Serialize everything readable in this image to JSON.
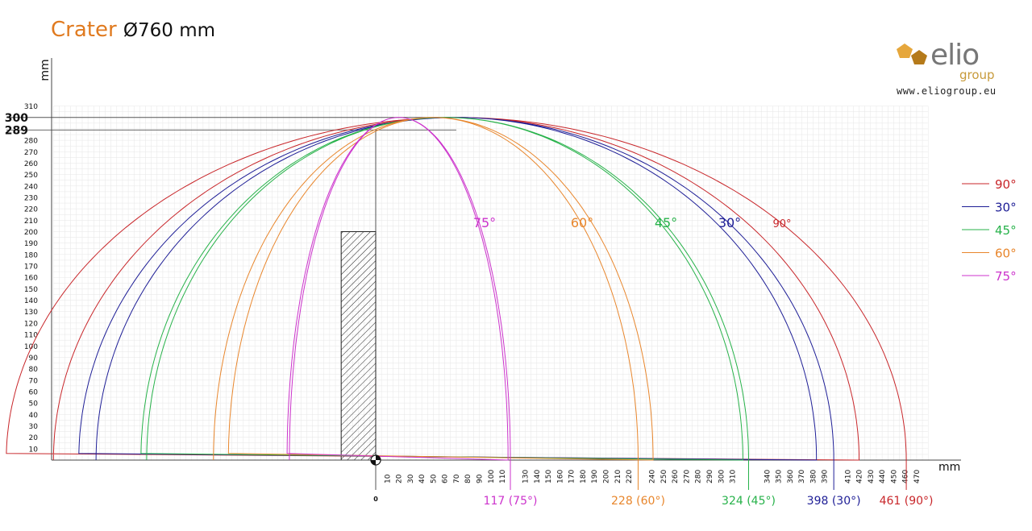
{
  "title": {
    "name": "Crater",
    "size": "Ø760 mm",
    "name_color": "#E07A1F"
  },
  "logo": {
    "brand": "elio",
    "sub": "group",
    "url": "www.eliogroup.eu",
    "mark": "pentagon-icon",
    "mark_colors": [
      "#E6A73C",
      "#B57A1A"
    ]
  },
  "chart_data": {
    "type": "line",
    "xlabel": "mm",
    "ylabel": "mm",
    "xlim": [
      -280,
      470
    ],
    "ylim": [
      0,
      310
    ],
    "x_ticks": [
      10,
      20,
      30,
      40,
      50,
      60,
      70,
      80,
      90,
      100,
      110,
      130,
      140,
      150,
      160,
      170,
      180,
      190,
      200,
      210,
      220,
      240,
      250,
      260,
      270,
      280,
      290,
      300,
      310,
      340,
      350,
      360,
      370,
      380,
      390,
      410,
      420,
      430,
      440,
      450,
      460,
      470
    ],
    "y_ticks": [
      10,
      20,
      30,
      40,
      50,
      60,
      70,
      80,
      90,
      100,
      110,
      120,
      130,
      140,
      150,
      160,
      170,
      180,
      190,
      200,
      210,
      220,
      230,
      240,
      250,
      260,
      270,
      280,
      310
    ],
    "origin_label": "0",
    "highlight_y": [
      {
        "value": 300,
        "label": "300"
      },
      {
        "value": 289,
        "label": "289"
      }
    ],
    "block": {
      "x": [
        -30,
        0
      ],
      "y": [
        0,
        200
      ]
    },
    "series": [
      {
        "name": "90°",
        "color": "#C8262A",
        "curve_label": "90°",
        "apex": [
          70,
          300
        ],
        "start_x": 0,
        "start_y": 289,
        "range": 461,
        "range_label": "461 (90°)",
        "left_x": -280
      },
      {
        "name": "30°",
        "color": "#1E1E96",
        "curve_label": "30°",
        "apex": [
          70,
          300
        ],
        "start_x": 0,
        "start_y": 289,
        "range": 398,
        "range_label": "398 (30°)",
        "left_x": -243
      },
      {
        "name": "45°",
        "color": "#27B24A",
        "curve_label": "45°",
        "apex": [
          60,
          300
        ],
        "start_x": 0,
        "start_y": 289,
        "range": 324,
        "range_label": "324 (45°)",
        "left_x": -199
      },
      {
        "name": "60°",
        "color": "#E8862C",
        "curve_label": "60°",
        "apex": [
          50,
          300
        ],
        "start_x": 0,
        "start_y": 289,
        "range": 228,
        "range_label": "228 (60°)",
        "left_x": -141
      },
      {
        "name": "75°",
        "color": "#CC33CC",
        "curve_label": "75°",
        "apex": [
          20,
          300
        ],
        "start_x": 0,
        "start_y": 289,
        "range": 117,
        "range_label": "117 (75°)",
        "left_x": -75
      }
    ],
    "legend_order": [
      "90°",
      "30°",
      "45°",
      "60°",
      "75°"
    ],
    "legend_position": "right",
    "grid": true
  }
}
